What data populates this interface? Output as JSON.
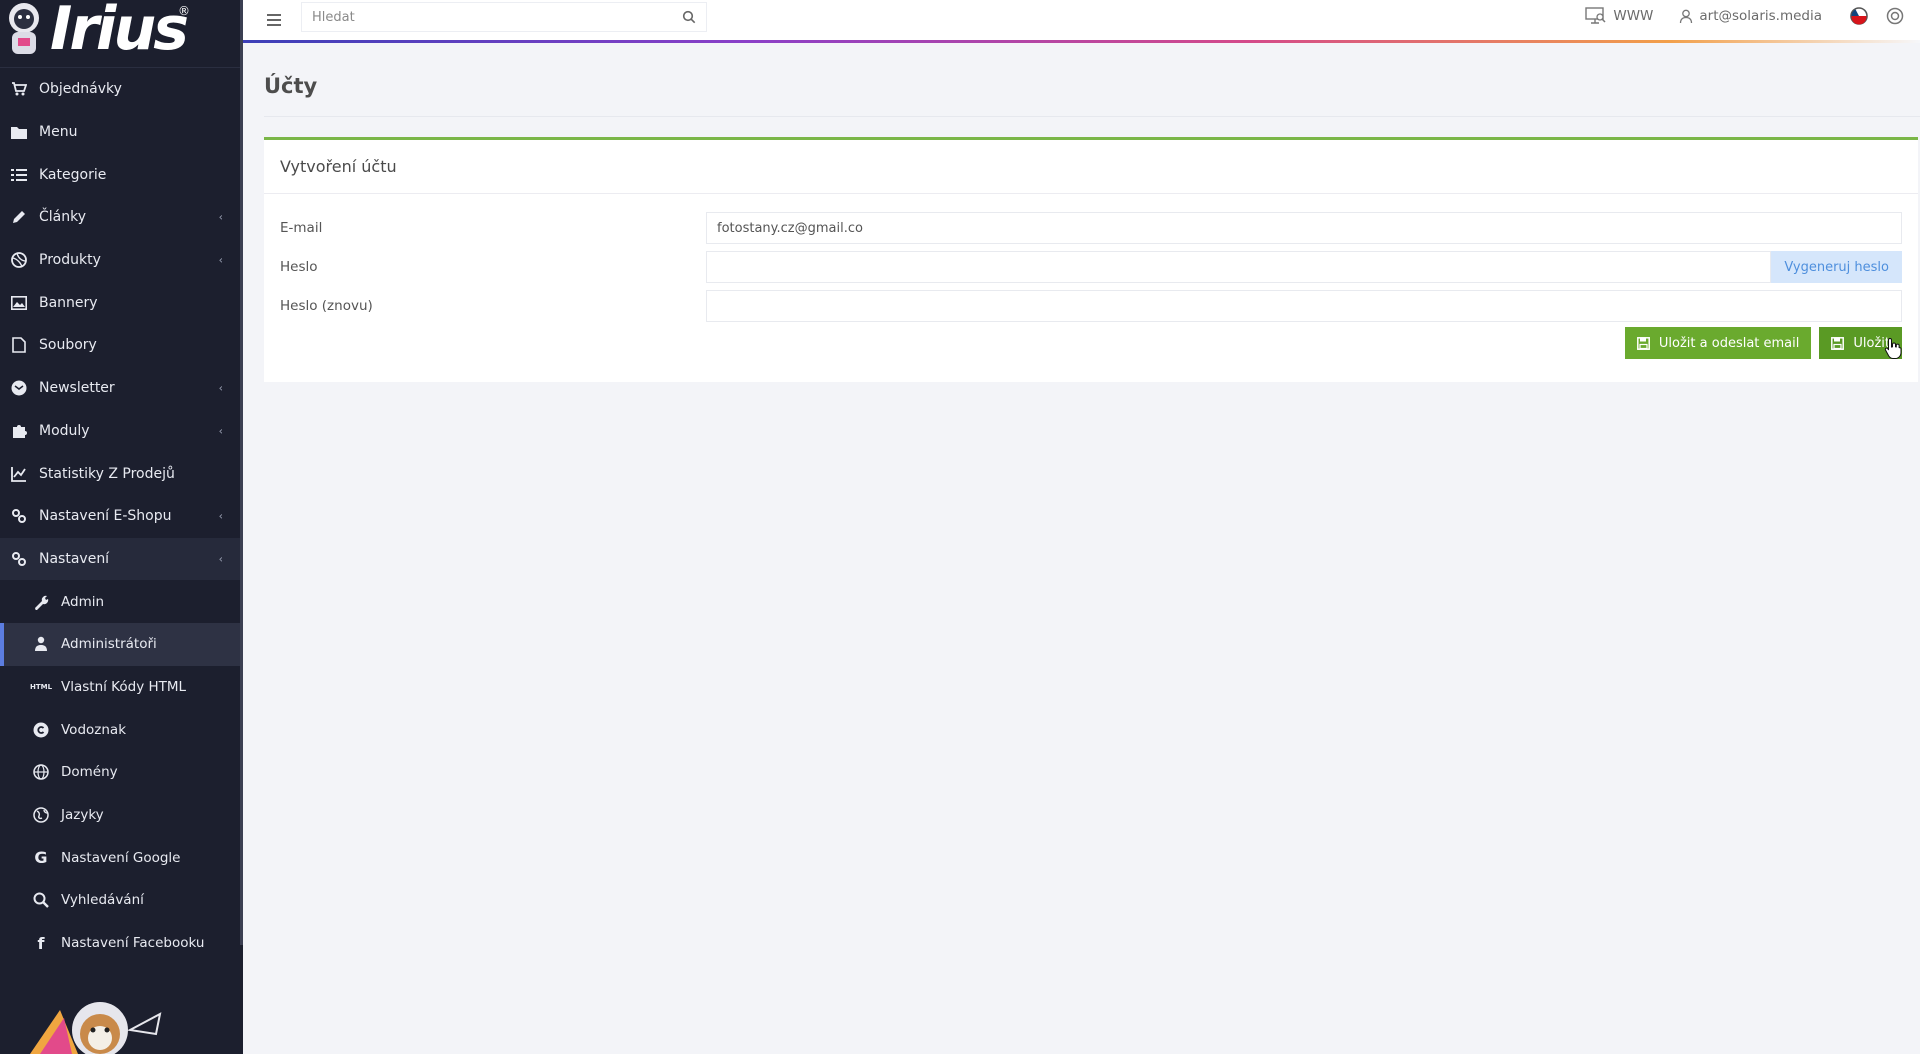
{
  "app": {
    "logo_text": "Irius",
    "reg_mark": "®"
  },
  "sidebar": {
    "items": [
      {
        "label": "Objednávky",
        "icon": "cart-icon",
        "has_chevron": false
      },
      {
        "label": "Menu",
        "icon": "folder-icon",
        "has_chevron": false
      },
      {
        "label": "Kategorie",
        "icon": "list-icon",
        "has_chevron": false
      },
      {
        "label": "Články",
        "icon": "pencil-icon",
        "has_chevron": true
      },
      {
        "label": "Produkty",
        "icon": "ball-icon",
        "has_chevron": true
      },
      {
        "label": "Bannery",
        "icon": "image-icon",
        "has_chevron": false
      },
      {
        "label": "Soubory",
        "icon": "file-icon",
        "has_chevron": false
      },
      {
        "label": "Newsletter",
        "icon": "mail-icon",
        "has_chevron": true
      },
      {
        "label": "Moduly",
        "icon": "puzzle-icon",
        "has_chevron": true
      },
      {
        "label": "Statistiky Z Prodejů",
        "icon": "chart-icon",
        "has_chevron": false
      },
      {
        "label": "Nastavení E-Shopu",
        "icon": "cogs-icon",
        "has_chevron": true
      },
      {
        "label": "Nastavení",
        "icon": "cogs-icon",
        "has_chevron": true
      }
    ],
    "subitems": [
      {
        "label": "Admin",
        "icon": "wrench-icon"
      },
      {
        "label": "Administrátoři",
        "icon": "user-icon"
      },
      {
        "label": "Vlastní Kódy HTML",
        "icon": "html-icon"
      },
      {
        "label": "Vodoznak",
        "icon": "copyright-icon"
      },
      {
        "label": "Domény",
        "icon": "globe-icon"
      },
      {
        "label": "Jazyky",
        "icon": "globe-alt-icon"
      },
      {
        "label": "Nastavení Google",
        "icon": "google-icon"
      },
      {
        "label": "Vyhledávání",
        "icon": "search-icon"
      },
      {
        "label": "Nastavení Facebooku",
        "icon": "facebook-icon"
      }
    ]
  },
  "topbar": {
    "search_placeholder": "Hledat",
    "www_label": "WWW",
    "user_email": "art@solaris.media"
  },
  "main": {
    "page_title": "Účty",
    "card_title": "Vytvoření účtu",
    "form": {
      "email_label": "E-mail",
      "email_value": "fotostany.cz@gmail.co",
      "password_label": "Heslo",
      "password_value": "",
      "password_again_label": "Heslo (znovu)",
      "password_again_value": "",
      "generate_label": "Vygeneruj heslo"
    },
    "actions": {
      "save_send_label": "Uložit a odeslat email",
      "save_label": "Uložit"
    }
  },
  "colors": {
    "sidebar_bg": "#1c1f2e",
    "accent_green": "#6aaa2e",
    "accent_blue": "#5c7de0",
    "card_border": "#7ab648"
  }
}
